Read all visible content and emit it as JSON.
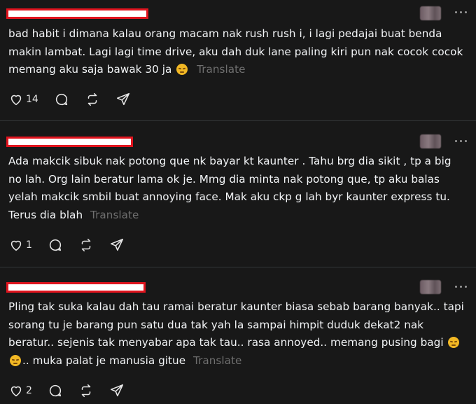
{
  "posts": [
    {
      "text": "bad habit i dimana kalau orang macam nak rush rush i, i lagi pedajai buat benda makin lambat. Lagi lagi time drive, aku dah duk lane paling kiri pun nak cocok cocok memang aku saja bawak 30 ja",
      "emojis": 1,
      "translate": "Translate",
      "likes": "14"
    },
    {
      "text": "Ada makcik sibuk nak potong que nk bayar kt kaunter . Tahu brg dia sikit , tp a big no lah. Org lain beratur lama ok je. Mmg dia minta nak potong que, tp aku balas yelah makcik smbil buat annoying face. Mak aku ckp g lah byr kaunter express tu. Terus dia blah",
      "emojis": 0,
      "translate": "Translate",
      "likes": "1"
    },
    {
      "text": "Pling tak suka kalau dah tau ramai beratur kaunter biasa sebab barang banyak.. tapi sorang tu je barang pun satu dua tak yah la sampai himpit duduk dekat2 nak beratur.. sejenis tak menyabar apa tak tau.. rasa annoyed.. memang pusing bagi",
      "text_after": ".. muka palat je manusia gitue",
      "emojis": 2,
      "translate": "Translate",
      "likes": "2"
    }
  ],
  "colors": {
    "background": "#181818",
    "text": "#f3f5f7",
    "muted": "#6f6f6f",
    "redaction": "#e0141e"
  },
  "icons": [
    "heart-icon",
    "comment-icon",
    "repost-icon",
    "share-icon",
    "more-icon"
  ]
}
